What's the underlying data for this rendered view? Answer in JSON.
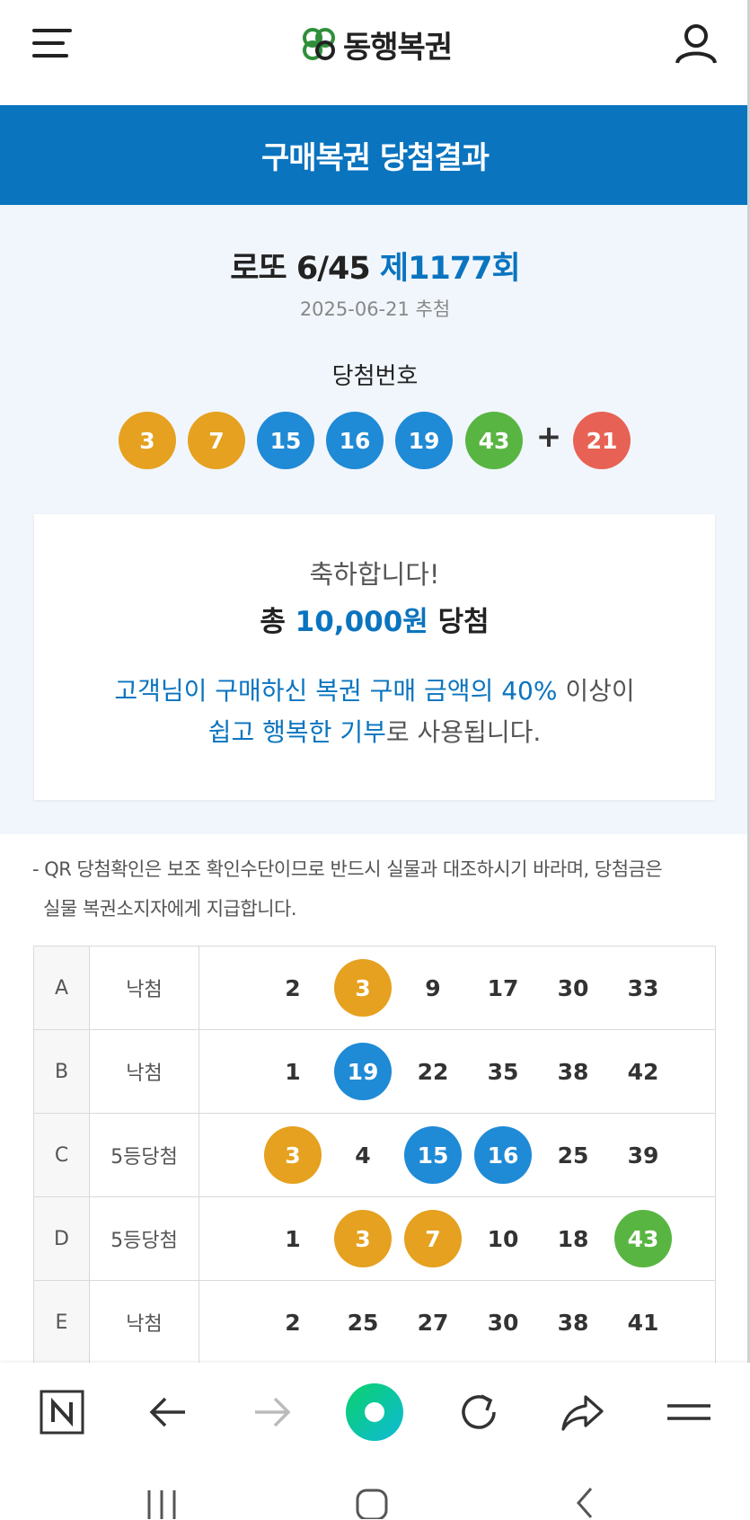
{
  "header": {
    "logo_text": "동행복권",
    "menu_icon": "hamburger-icon",
    "user_icon": "user-icon"
  },
  "banner": {
    "title": "구매복권 당첨결과"
  },
  "draw": {
    "game_name": "로또 6/45",
    "round": "제1177회",
    "date": "2025-06-21 추첨",
    "numbers_label": "당첨번호",
    "numbers": [
      3,
      7,
      15,
      16,
      19,
      43
    ],
    "plus_sign": "+",
    "bonus": 21
  },
  "result": {
    "congrats": "축하합니다!",
    "prize_prefix": "총",
    "prize_amount": "10,000원",
    "prize_suffix": "당첨",
    "donation_line1_hl": "고객님이 구매하신 복권 구매 금액의 40%",
    "donation_line1_rest": " 이상이",
    "donation_line2_hl": "쉽고 행복한 기부",
    "donation_line2_rest": "로 사용됩니다."
  },
  "notice": {
    "line1": "- QR 당첨확인은 보조 확인수단이므로 반드시 실물과 대조하시기 바라며, 당첨금은",
    "line2": "실물 복권소지자에게 지급합니다."
  },
  "tickets": [
    {
      "game": "A",
      "status": "낙첨",
      "numbers": [
        2,
        3,
        9,
        17,
        30,
        33
      ],
      "hits": [
        3
      ]
    },
    {
      "game": "B",
      "status": "낙첨",
      "numbers": [
        1,
        19,
        22,
        35,
        38,
        42
      ],
      "hits": [
        19
      ]
    },
    {
      "game": "C",
      "status": "5등당첨",
      "numbers": [
        3,
        4,
        15,
        16,
        25,
        39
      ],
      "hits": [
        3,
        15,
        16
      ]
    },
    {
      "game": "D",
      "status": "5등당첨",
      "numbers": [
        1,
        3,
        7,
        10,
        18,
        43
      ],
      "hits": [
        3,
        7,
        43
      ]
    },
    {
      "game": "E",
      "status": "낙첨",
      "numbers": [
        2,
        25,
        27,
        30,
        38,
        41
      ],
      "hits": []
    }
  ],
  "ball_colors": {
    "1-10": "#e5a11f",
    "11-20": "#1f8ad6",
    "21-30": "#e76254",
    "31-40": "#999999",
    "41-45": "#59b542"
  },
  "brand_color": "#0a74bf",
  "browser_bar": {
    "icons": [
      "naver-n-icon",
      "back-arrow-icon",
      "forward-arrow-icon",
      "home-circle-icon",
      "refresh-icon",
      "share-icon",
      "menu-icon"
    ]
  },
  "android_nav": {
    "icons": [
      "recent-apps-icon",
      "home-icon",
      "back-icon"
    ]
  }
}
